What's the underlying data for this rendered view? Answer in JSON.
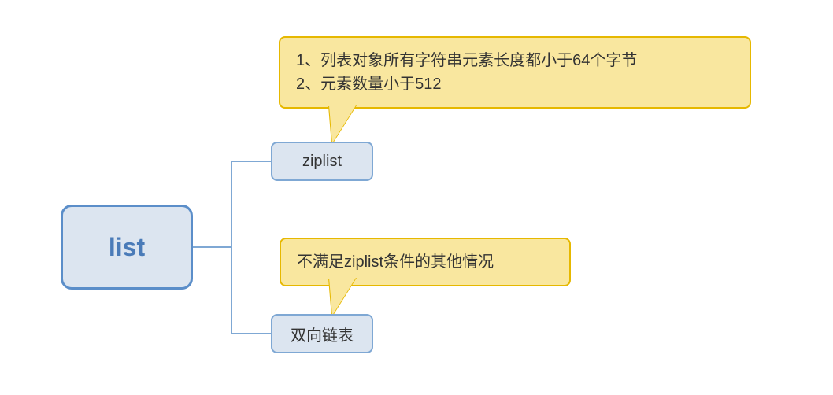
{
  "root": {
    "label": "list"
  },
  "children": [
    {
      "label": "ziplist",
      "note": "1、列表对象所有字符串元素长度都小于64个字节\n2、元素数量小于512"
    },
    {
      "label": "双向链表",
      "note": "不满足ziplist条件的其他情况"
    }
  ],
  "colors": {
    "node_fill": "#dce5f0",
    "node_border": "#5b8ec9",
    "callout_fill": "#f9e79f",
    "callout_border": "#e6b800"
  }
}
